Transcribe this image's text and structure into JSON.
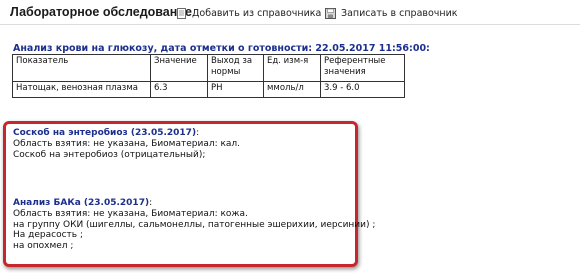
{
  "header": {
    "title": "Лабораторное обследование",
    "add_label": "Добавить из справочника",
    "save_label": "Записать в справочник"
  },
  "glucose": {
    "title": "Анализ крови на глюкозу, дата отметки о готовности: 22.05.2017 11:56:00:",
    "columns": [
      "Показатель",
      "Значение",
      "Выход за нормы",
      "Ед. изм-я",
      "Референтные значения"
    ],
    "rows": [
      [
        "Натощак, венозная плазма",
        "6.3",
        "РН",
        "ммоль/л",
        "3.9 - 6.0"
      ]
    ]
  },
  "entero": {
    "title": "Соскоб на энтеробиоз (23.05.2017)",
    "title_suffix": ":",
    "line1": "Область взятия:  не указана, Биоматериал:  кал.",
    "line2": "Соскоб на энтеробиоз (отрицательный);"
  },
  "bak": {
    "title": "Анализ БАКа (23.05.2017)",
    "title_suffix": ":",
    "line1": "Область взятия:  не указана, Биоматериал:  кожа.",
    "line2": "на группу ОКИ (шигеллы, сальмонеллы, патогенные эшерихии, иерсинии) ;",
    "line3": "На дерасость  ;",
    "line4": "на опохмел ;"
  },
  "colors": {
    "title_blue": "#1c2f8c",
    "highlight_red": "#c6272d"
  },
  "icons": [
    "document-icon",
    "save-icon"
  ]
}
